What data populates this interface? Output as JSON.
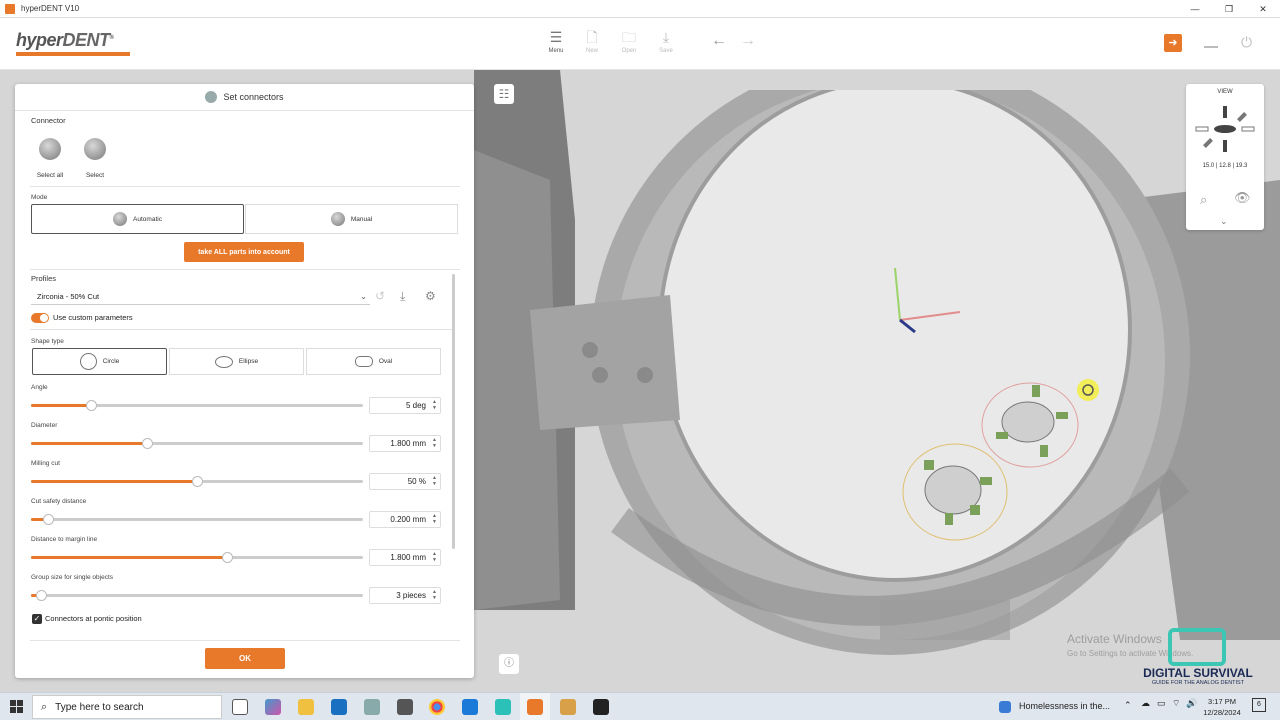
{
  "window": {
    "title": "hyperDENT V10"
  },
  "toolbar": {
    "logo_hyper": "hyper",
    "logo_dent": "DENT",
    "logo_mark": "®",
    "menu": "Menu",
    "new": "New",
    "open": "Open",
    "save": "Save"
  },
  "panel": {
    "title": "Set connectors",
    "connector_label": "Connector",
    "select_all": "Select all",
    "select": "Select",
    "mode_label": "Mode",
    "mode_automatic": "Automatic",
    "mode_manual": "Manual",
    "take_all_button": "take ALL parts into account",
    "profiles_label": "Profiles",
    "profile_value": "Zirconia - 50% Cut",
    "use_custom": "Use custom parameters",
    "shape_type_label": "Shape type",
    "shape_circle": "Circle",
    "shape_ellipse": "Ellipse",
    "shape_oval": "Oval",
    "params": [
      {
        "label": "Angle",
        "value": "5",
        "unit": "deg",
        "fraction": 0.18
      },
      {
        "label": "Diameter",
        "value": "1.800",
        "unit": "mm",
        "fraction": 0.35
      },
      {
        "label": "Milling cut",
        "value": "50",
        "unit": "%",
        "fraction": 0.5
      },
      {
        "label": "Cut safety distance",
        "value": "0.200",
        "unit": "mm",
        "fraction": 0.05
      },
      {
        "label": "Distance to margin line",
        "value": "1.800",
        "unit": "mm",
        "fraction": 0.59
      },
      {
        "label": "Group size for single objects",
        "value": "3",
        "unit": "pieces",
        "fraction": 0.03
      }
    ],
    "connectors_pontic": "Connectors at pontic position",
    "ok_button": "OK"
  },
  "view_widget": {
    "title": "VIEW",
    "values": "15.0  | 12.8 | 19.3"
  },
  "overlay": {
    "activate_title": "Activate Windows",
    "activate_sub": "Go to Settings to activate Windows.",
    "brand_title": "DIGITAL SURVIVAL",
    "brand_sub": "GUIDE FOR THE ANALOG DENTIST"
  },
  "taskbar": {
    "search_placeholder": "Type here to search",
    "news": "Homelessness in the...",
    "time": "3:17 PM",
    "date": "12/28/2024",
    "notifications": "6"
  },
  "colors": {
    "accent": "#e8792b"
  }
}
